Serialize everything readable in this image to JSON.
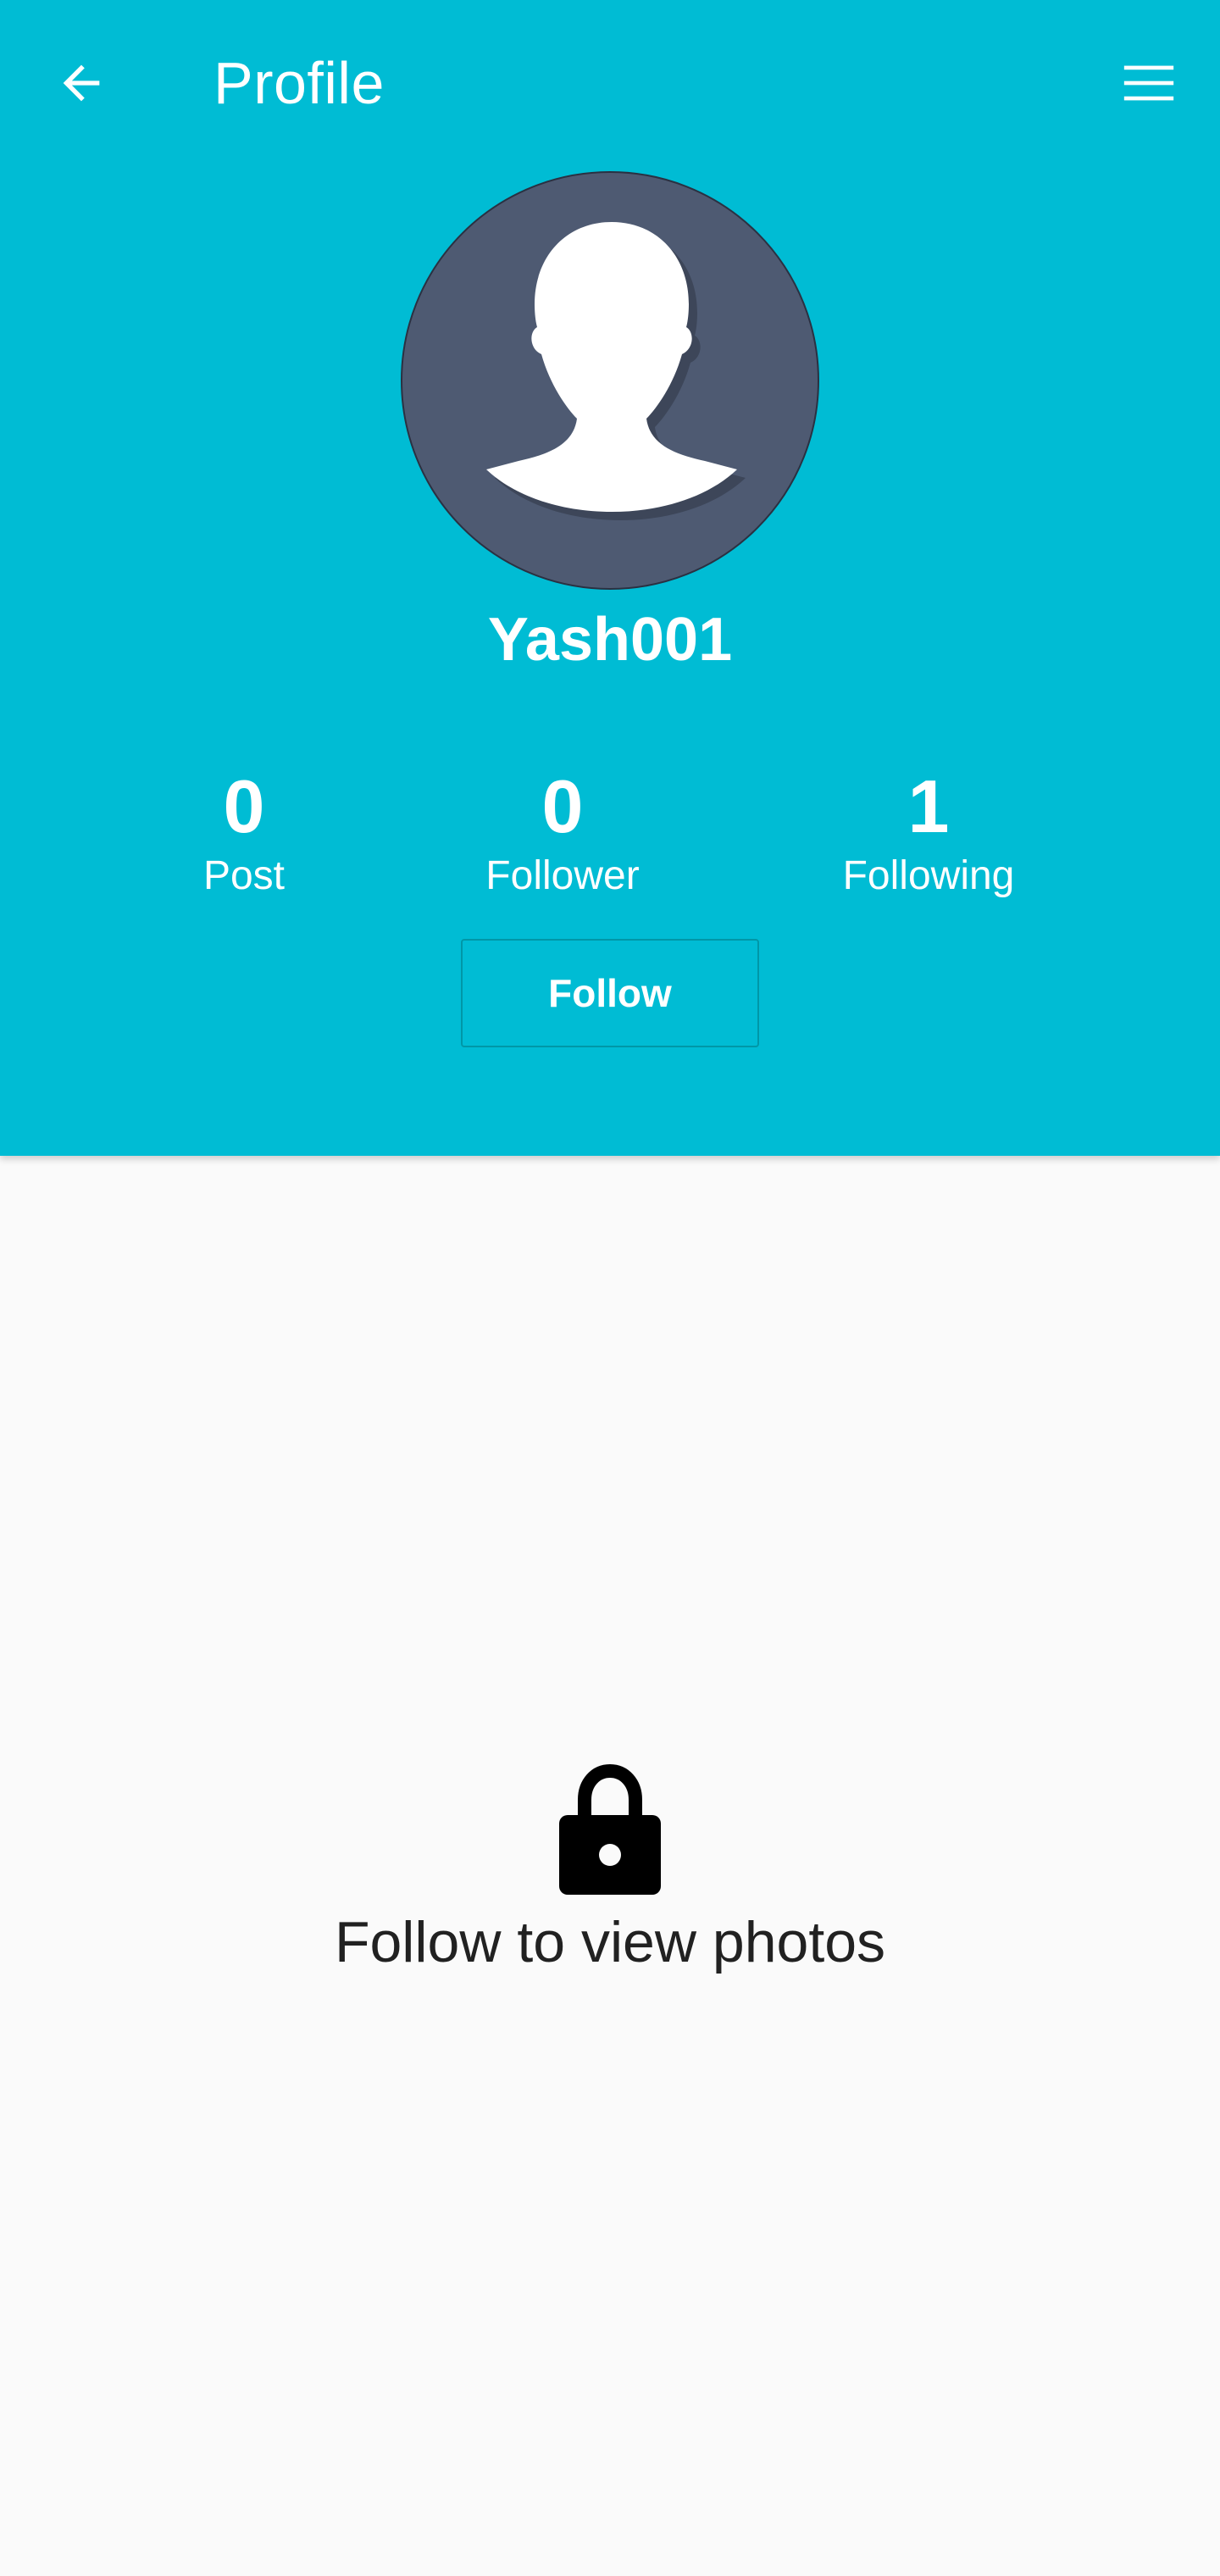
{
  "toolbar": {
    "title": "Profile",
    "back_icon": "arrow-left-icon",
    "menu_icon": "hamburger-menu-icon"
  },
  "profile": {
    "avatar_icon": "default-person-avatar",
    "username": "Yash001"
  },
  "stats": [
    {
      "value": "0",
      "label": "Post"
    },
    {
      "value": "0",
      "label": "Follower"
    },
    {
      "value": "1",
      "label": "Following"
    }
  ],
  "follow_button": {
    "label": "Follow"
  },
  "locked_content": {
    "icon": "lock-icon",
    "message": "Follow to view photos"
  },
  "colors": {
    "header_bg": "#00bcd4",
    "avatar_bg": "#4e5a72",
    "body_bg": "#fafafa"
  }
}
